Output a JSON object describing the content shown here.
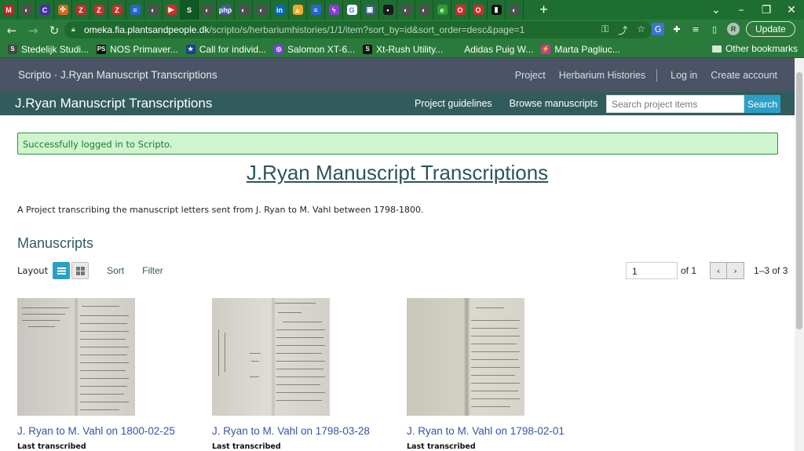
{
  "browser": {
    "tabs": [
      {
        "icon": "gmail-icon",
        "color": "#c5221f",
        "glyph": "M"
      },
      {
        "icon": "chrome-page-icon",
        "color": "#4f4f4f",
        "glyph": "◐"
      },
      {
        "icon": "cursor-icon",
        "color": "#4b2ca8",
        "glyph": "C"
      },
      {
        "icon": "pinwheel-icon",
        "color": "#d46a1b",
        "glyph": "✣"
      },
      {
        "icon": "zotero-icon",
        "color": "#c0302d",
        "glyph": "Z"
      },
      {
        "icon": "zotero-icon",
        "color": "#c0302d",
        "glyph": "Z"
      },
      {
        "icon": "zotero-icon",
        "color": "#c0302d",
        "glyph": "Z"
      },
      {
        "icon": "google-docs-icon",
        "color": "#2a63d6",
        "glyph": "≡"
      },
      {
        "icon": "chrome-page-icon",
        "color": "#4f4f4f",
        "glyph": "◐"
      },
      {
        "icon": "youtube-icon",
        "color": "#d62b2b",
        "glyph": "▶"
      },
      {
        "icon": "scripto-icon",
        "color": "#0f5a22",
        "glyph": "S",
        "active": true
      },
      {
        "icon": "chrome-page-icon",
        "color": "#4f4f4f",
        "glyph": "◐"
      },
      {
        "icon": "php-icon",
        "color": "#4a55a6",
        "glyph": "php"
      },
      {
        "icon": "chrome-page-icon",
        "color": "#4f4f4f",
        "glyph": "◐"
      },
      {
        "icon": "chrome-page-icon",
        "color": "#4f4f4f",
        "glyph": "◐"
      },
      {
        "icon": "linkedin-icon",
        "color": "#0a66c2",
        "glyph": "in"
      },
      {
        "icon": "google-ads-icon",
        "color": "#f3a722",
        "glyph": "▲"
      },
      {
        "icon": "google-docs-icon",
        "color": "#2a63d6",
        "glyph": "≡"
      },
      {
        "icon": "bolt-icon",
        "color": "#8a3ad8",
        "glyph": "ϟ"
      },
      {
        "icon": "google-icon",
        "color": "#ffffff",
        "glyph": "G"
      },
      {
        "icon": "window-icon",
        "color": "#3b5d8a",
        "glyph": "▣"
      },
      {
        "icon": "dark-page-icon",
        "color": "#1a1a1a",
        "glyph": "•"
      },
      {
        "icon": "chrome-page-icon",
        "color": "#4f4f4f",
        "glyph": "◐"
      },
      {
        "icon": "chrome-page-icon",
        "color": "#4f4f4f",
        "glyph": "◐"
      },
      {
        "icon": "edge-icon",
        "color": "#2f9d2f",
        "glyph": "e"
      },
      {
        "icon": "opera-icon",
        "color": "#d02b2b",
        "glyph": "O"
      },
      {
        "icon": "opera-icon",
        "color": "#d02b2b",
        "glyph": "O"
      },
      {
        "icon": "book-icon",
        "color": "#111111",
        "glyph": "▮"
      },
      {
        "icon": "chrome-page-icon",
        "color": "#4f4f4f",
        "glyph": "◐"
      }
    ],
    "url_host": "omeka.fia.plantsandpeople.dk",
    "url_path": "/scripto/s/herbariumhistories/1/1/item?sort_by=id&sort_order=desc&page=1",
    "update_label": "Update",
    "avatar_letter": "R",
    "bookmarks": [
      {
        "label": "Stedelijk Studi...",
        "glyph": "S",
        "color": "#444444"
      },
      {
        "label": "NOS Primaver...",
        "glyph": "PS",
        "color": "#111111"
      },
      {
        "label": "Call for individ...",
        "glyph": "★",
        "color": "#1e3f9a"
      },
      {
        "label": "Salomon XT-6...",
        "glyph": "◎",
        "color": "#7b3fd6"
      },
      {
        "label": "Xt-Rush Utility...",
        "glyph": "S",
        "color": "#111111"
      },
      {
        "label": "Adidas Puig W...",
        "glyph": "",
        "color": "#2a7a3b"
      },
      {
        "label": "Marta Pagliuc...",
        "glyph": "⚡",
        "color": "#d0368b"
      }
    ],
    "other_bookmarks": "Other bookmarks"
  },
  "site": {
    "brand": "Scripto · J.Ryan Manuscript Transcriptions",
    "top_links": {
      "project": "Project",
      "herbarium": "Herbarium Histories",
      "login": "Log in",
      "create": "Create account"
    },
    "project_title": "J.Ryan Manuscript Transcriptions",
    "project_links": {
      "guidelines": "Project guidelines",
      "browse": "Browse manuscripts"
    },
    "search_placeholder": "Search project items",
    "search_button": "Search",
    "accent": "#2ba0c7"
  },
  "page": {
    "alert": "Successfully logged in to Scripto.",
    "title": "J.Ryan Manuscript Transcriptions",
    "description": "A Project transcribing the manuscript letters sent from J. Ryan to M. Vahl between 1798-1800.",
    "section_heading": "Manuscripts",
    "layout_label": "Layout",
    "sort_label": "Sort",
    "filter_label": "Filter",
    "pager": {
      "page": "1",
      "of": "of 1",
      "count": "1–3 of 3"
    },
    "items": [
      {
        "title": "J. Ryan to M. Vahl on 1800-02-25",
        "subtitle": "Last transcribed"
      },
      {
        "title": "J. Ryan to M. Vahl on 1798-03-28",
        "subtitle": "Last transcribed"
      },
      {
        "title": "J. Ryan to M. Vahl on 1798-02-01",
        "subtitle": "Last transcribed"
      }
    ]
  }
}
